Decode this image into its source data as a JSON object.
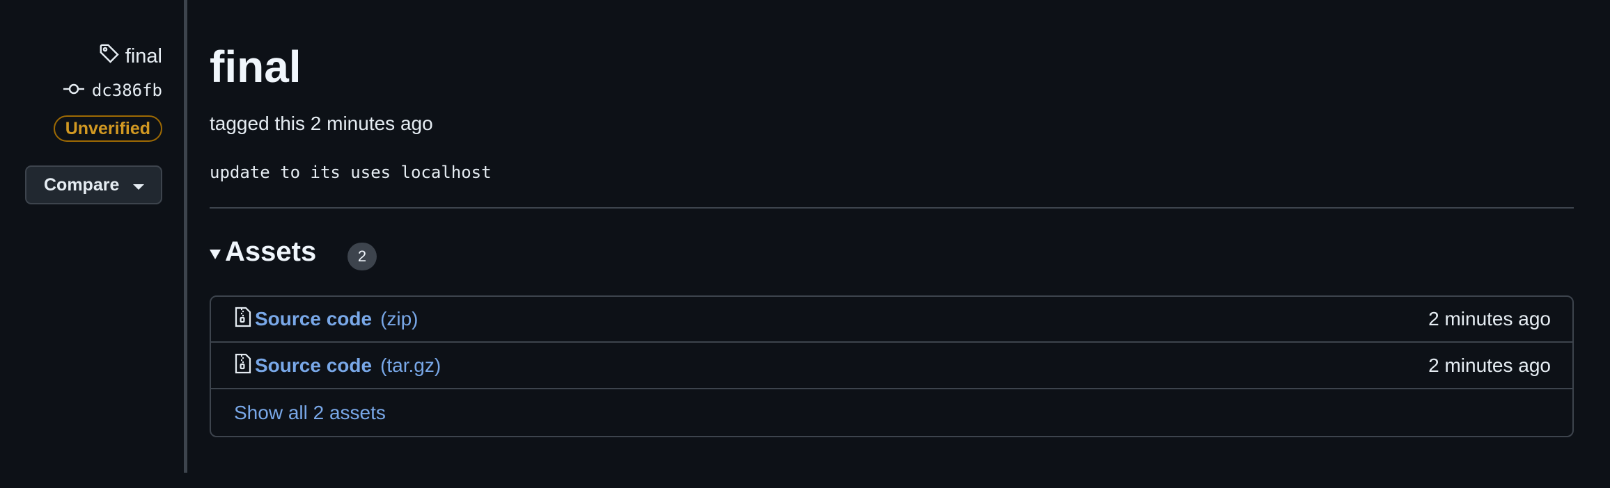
{
  "sidebar": {
    "tag_name": "final",
    "commit": "dc386fb",
    "badge": "Unverified",
    "compare_label": "Compare"
  },
  "release": {
    "title": "final",
    "tagged_text": "tagged this 2 minutes ago",
    "message": "update to its uses localhost"
  },
  "assets": {
    "heading": "Assets",
    "count": "2",
    "items": [
      {
        "name": "Source code",
        "ext": "(zip)",
        "time": "2 minutes ago",
        "icon": "file-zip-icon"
      },
      {
        "name": "Source code",
        "ext": "(tar.gz)",
        "time": "2 minutes ago",
        "icon": "file-zip-icon"
      }
    ],
    "show_all": "Show all 2 assets"
  },
  "colors": {
    "background": "#0d1117",
    "link": "#79a8e8",
    "badge_warning": "#d29922",
    "border": "#3d444d"
  }
}
